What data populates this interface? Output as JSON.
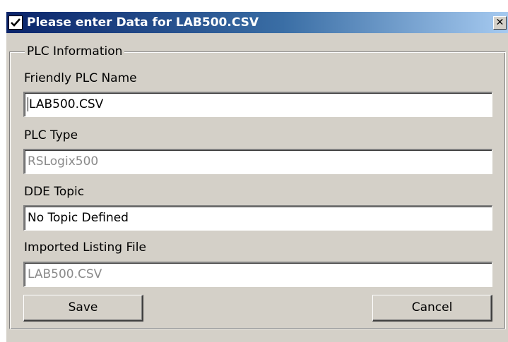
{
  "window": {
    "title": "Please enter Data for LAB500.CSV",
    "close_glyph": "✕",
    "icon": "checkmark-icon"
  },
  "group": {
    "legend": "PLC Information"
  },
  "fields": {
    "friendly_name": {
      "label": "Friendly PLC Name",
      "value": "LAB500.CSV",
      "editable": true
    },
    "plc_type": {
      "label": "PLC Type",
      "value": "RSLogix500",
      "editable": false
    },
    "dde_topic": {
      "label": "DDE Topic",
      "value": "No Topic Defined",
      "editable": true
    },
    "listing_file": {
      "label": "Imported Listing File",
      "value": "LAB500.CSV",
      "editable": false
    }
  },
  "buttons": {
    "save": "Save",
    "cancel": "Cancel"
  },
  "colors": {
    "title_gradient_start": "#0a246a",
    "title_gradient_end": "#a6caf0",
    "dialog_face": "#d4d0c8",
    "disabled_text": "#8a8a8a"
  }
}
